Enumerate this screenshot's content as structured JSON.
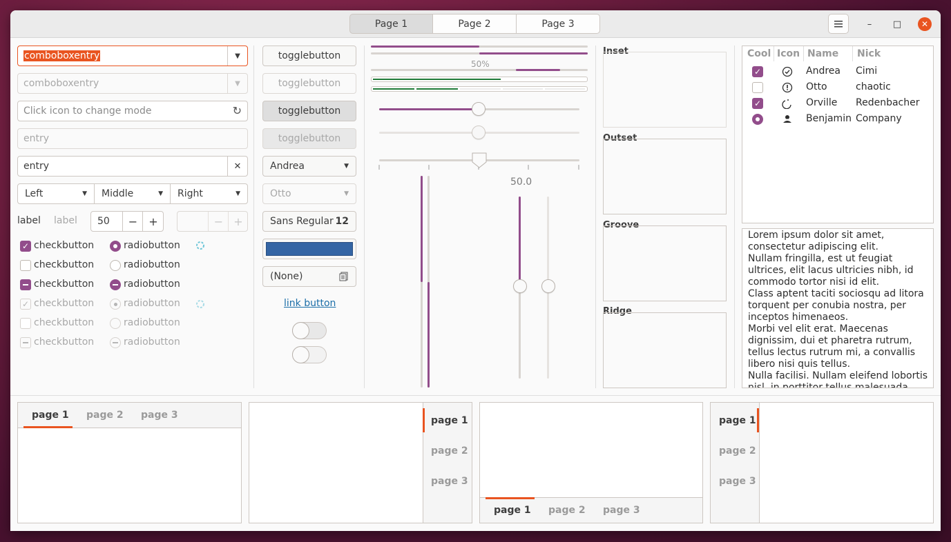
{
  "header": {
    "tabs": [
      "Page 1",
      "Page 2",
      "Page 3"
    ],
    "active_tab": 0,
    "menu_icon": "hamburger-menu-icon",
    "minimize_glyph": "–",
    "maximize_glyph": "□",
    "close_glyph": "✕"
  },
  "col1": {
    "combo1_value": "comboboxentry",
    "combo2_value": "comboboxentry",
    "mode_entry_placeholder": "Click icon to change mode",
    "entry_disabled_placeholder": "entry",
    "entry_value": "entry",
    "clear_glyph": "✕",
    "reload_glyph": "↻",
    "dropdowns": [
      "Left",
      "Middle",
      "Right"
    ],
    "label1": "label",
    "label2": "label",
    "spin_value": "50",
    "spin_minus": "−",
    "spin_plus": "+",
    "checkbuttons": [
      {
        "label": "checkbutton",
        "state": "checked",
        "disabled": false
      },
      {
        "label": "checkbutton",
        "state": "unchecked",
        "disabled": false
      },
      {
        "label": "checkbutton",
        "state": "mixed",
        "disabled": false
      },
      {
        "label": "checkbutton",
        "state": "checked",
        "disabled": true
      },
      {
        "label": "checkbutton",
        "state": "unchecked",
        "disabled": true
      },
      {
        "label": "checkbutton",
        "state": "mixed",
        "disabled": true
      }
    ],
    "radiobuttons": [
      {
        "label": "radiobutton",
        "state": "checked",
        "disabled": false
      },
      {
        "label": "radiobutton",
        "state": "unchecked",
        "disabled": false
      },
      {
        "label": "radiobutton",
        "state": "mixed",
        "disabled": false
      },
      {
        "label": "radiobutton",
        "state": "checked",
        "disabled": true
      },
      {
        "label": "radiobutton",
        "state": "unchecked",
        "disabled": true
      },
      {
        "label": "radiobutton",
        "state": "mixed",
        "disabled": true
      }
    ]
  },
  "col2": {
    "togglebuttons": [
      "togglebutton",
      "togglebutton",
      "togglebutton",
      "togglebutton"
    ],
    "combo1": "Andrea",
    "combo2": "Otto",
    "font_name": "Sans Regular",
    "font_size": "12",
    "color_swatch": "#3465a4",
    "file_chooser": "(None)",
    "link": "link button",
    "switch1_on": false,
    "switch2_on": false
  },
  "col3": {
    "progress_label": "50%",
    "progress_fraction": 0.5,
    "scale_value_label": "50.0",
    "scale_fraction": 0.5
  },
  "frames": [
    "Inset",
    "Outset",
    "Groove",
    "Ridge"
  ],
  "tree": {
    "headers": [
      "Cool",
      "Icon",
      "Name",
      "Nick"
    ],
    "rows": [
      {
        "cool": "checked",
        "icon": "check-circle-icon",
        "name": "Andrea",
        "nick": "Cimi"
      },
      {
        "cool": "unchecked",
        "icon": "alert-circle-icon",
        "name": "Otto",
        "nick": "chaotic"
      },
      {
        "cool": "checked",
        "icon": "moon-icon",
        "name": "Orville",
        "nick": "Redenbacher"
      },
      {
        "cool": "radio-checked",
        "icon": "person-icon",
        "name": "Benjamin",
        "nick": "Company"
      }
    ]
  },
  "textview": {
    "lines": [
      "Lorem ipsum dolor sit amet,",
      "consectetur adipiscing elit.",
      "Nullam fringilla, est ut feugiat",
      "ultrices, elit lacus ultricies nibh, id",
      "commodo tortor nisi id elit.",
      "Class aptent taciti sociosqu ad litora",
      "torquent per conubia nostra, per",
      "inceptos himenaeos.",
      "Morbi vel elit erat. Maecenas",
      "dignissim, dui et pharetra rutrum,",
      "tellus lectus rutrum mi, a convallis",
      "libero nisi quis tellus.",
      "Nulla facilisi. Nullam eleifend lobortis",
      "nisl, in porttitor tellus malesuada"
    ]
  },
  "notebooks": {
    "tabs": [
      "page 1",
      "page 2",
      "page 3"
    ],
    "active": 0
  },
  "colors": {
    "accent": "#e95420",
    "purple": "#924d8b",
    "green": "#1f7a38"
  }
}
